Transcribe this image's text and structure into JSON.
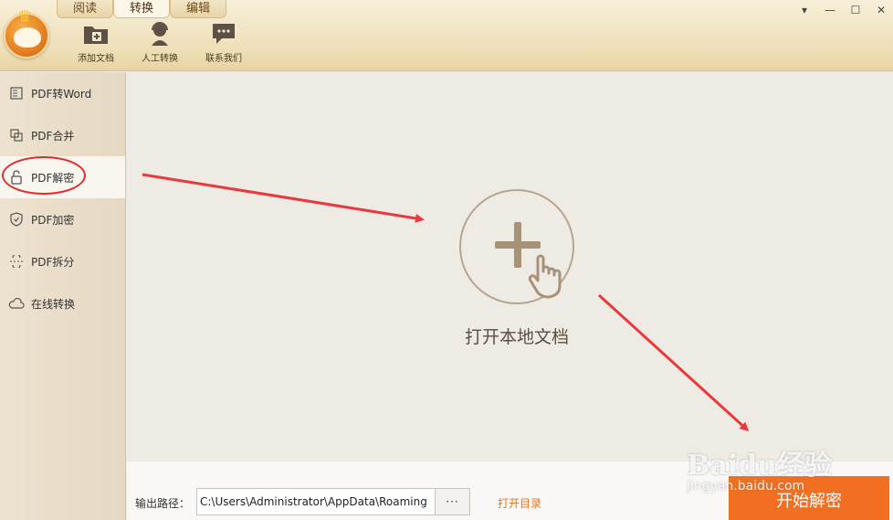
{
  "tabs": [
    {
      "label": "阅读"
    },
    {
      "label": "转换"
    },
    {
      "label": "编辑"
    }
  ],
  "window_controls": {
    "menu": "▾",
    "minimize": "—",
    "maximize": "☐",
    "close": "✕"
  },
  "toolbar": [
    {
      "label": "添加文档",
      "icon": "add-folder-icon"
    },
    {
      "label": "人工转换",
      "icon": "support-agent-icon"
    },
    {
      "label": "联系我们",
      "icon": "chat-bubble-icon"
    }
  ],
  "sidebar": {
    "items": [
      {
        "label": "PDF转Word",
        "icon": "word-doc-icon"
      },
      {
        "label": "PDF合并",
        "icon": "merge-icon"
      },
      {
        "label": "PDF解密",
        "icon": "unlock-icon",
        "active": true
      },
      {
        "label": "PDF加密",
        "icon": "shield-icon"
      },
      {
        "label": "PDF拆分",
        "icon": "split-icon"
      },
      {
        "label": "在线转换",
        "icon": "cloud-icon"
      }
    ]
  },
  "main": {
    "open_local_label": "打开本地文档"
  },
  "bottom": {
    "output_label": "输出路径：",
    "output_path": "C:\\Users\\Administrator\\AppData\\Roaming",
    "browse_label": "···",
    "open_dir_label": "打开目录",
    "start_label": "开始解密"
  },
  "watermark": {
    "line1": "Baidu经验",
    "line2": "jingyan.baidu.com"
  },
  "colors": {
    "accent": "#f26f21",
    "annotation": "#e02b2b",
    "link": "#e8741c"
  }
}
